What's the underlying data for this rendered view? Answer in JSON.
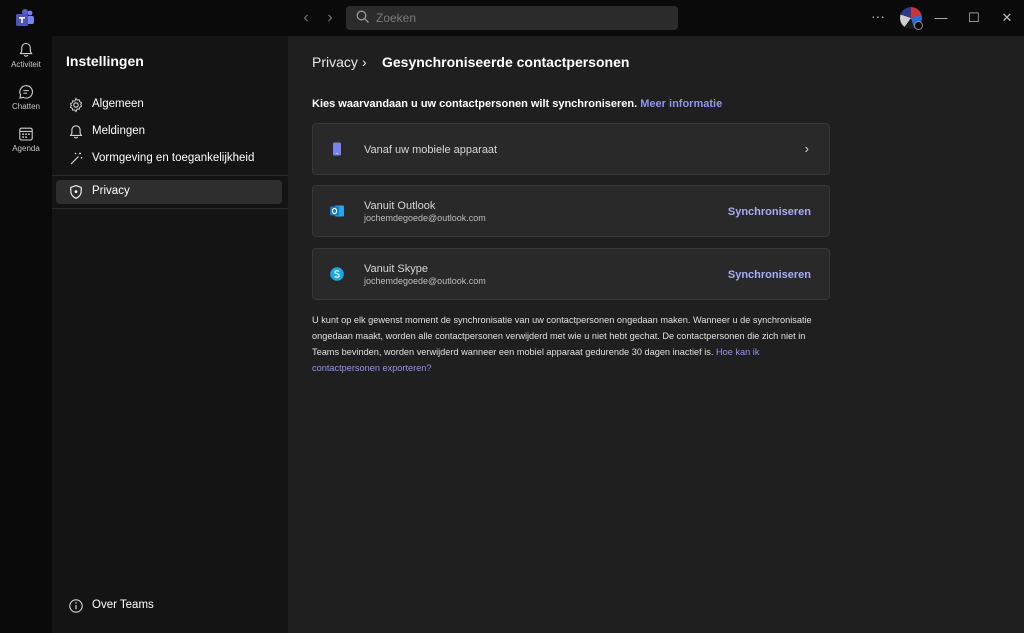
{
  "titlebar": {
    "search_placeholder": "Zoeken",
    "more_label": "···",
    "minimize_label": "—",
    "maximize_label": "☐",
    "close_label": "✕"
  },
  "rail": {
    "items": [
      {
        "label": "Activiteit",
        "icon": "bell-icon"
      },
      {
        "label": "Chatten",
        "icon": "chat-icon"
      },
      {
        "label": "Agenda",
        "icon": "calendar-icon"
      }
    ]
  },
  "sidebar": {
    "title": "Instellingen",
    "items": [
      {
        "label": "Algemeen",
        "icon": "gear-icon"
      },
      {
        "label": "Meldingen",
        "icon": "bell-icon"
      },
      {
        "label": "Vormgeving en toegankelijkheid",
        "icon": "magic-wand-icon"
      },
      {
        "label": "Privacy",
        "icon": "shield-icon",
        "active": true
      }
    ],
    "bottom_item": {
      "label": "Over Teams",
      "icon": "info-icon"
    }
  },
  "main": {
    "breadcrumb_parent": "Privacy",
    "breadcrumb_separator": "›",
    "breadcrumb_current": "Gesynchroniseerde contactpersonen",
    "intro_text": "Kies waarvandaan u uw contactpersonen wilt synchroniseren.",
    "intro_link": "Meer informatie",
    "cards": [
      {
        "title": "Vanaf uw mobiele apparaat",
        "icon": "mobile-phone-icon",
        "chevron": "›"
      },
      {
        "title": "Vanuit Outlook",
        "subtitle": "jochemdegoede@outlook.com",
        "action": "Synchroniseren",
        "icon": "outlook-icon"
      },
      {
        "title": "Vanuit Skype",
        "subtitle": "jochemdegoede@outlook.com",
        "action": "Synchroniseren",
        "icon": "skype-icon"
      }
    ],
    "footnote_text": "U kunt op elk gewenst moment de synchronisatie van uw contactpersonen ongedaan maken. Wanneer u de synchronisatie ongedaan maakt, worden alle contactpersonen verwijderd met wie u niet hebt gechat. De contactpersonen die zich niet in Teams bevinden, worden verwijderd wanneer een mobiel apparaat gedurende 30 dagen inactief is.",
    "footnote_link": "Hoe kan ik contactpersonen exporteren?"
  },
  "colors": {
    "accent": "#8f95ef",
    "teams_purple": "#5b5fc7",
    "outlook_blue": "#0f78d4",
    "skype_blue": "#1aa7e8"
  }
}
